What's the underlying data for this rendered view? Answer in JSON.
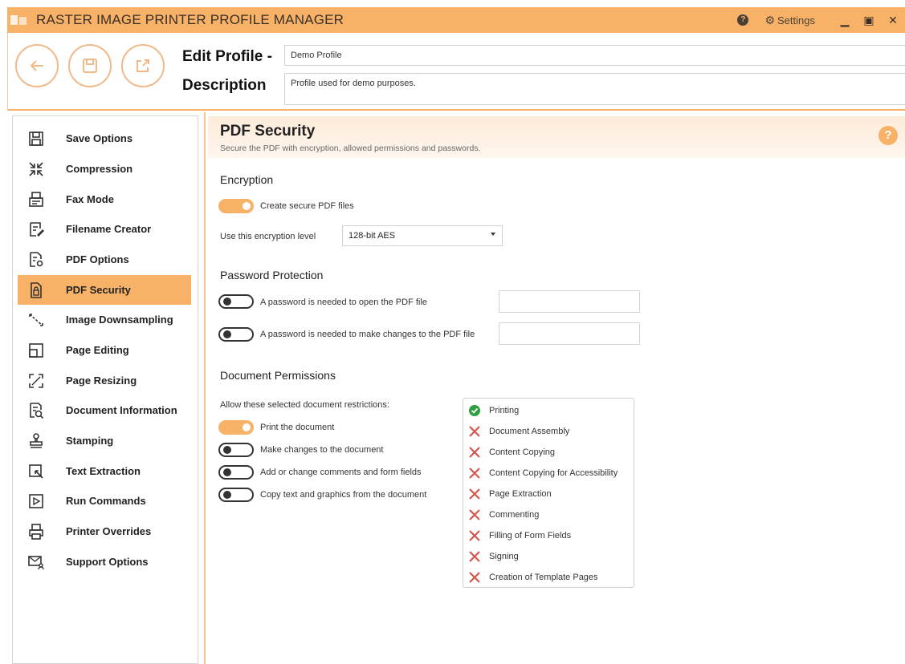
{
  "app": {
    "title": "RASTER IMAGE PRINTER PROFILE MANAGER",
    "settings_label": "Settings"
  },
  "header": {
    "profile_label": "Edit Profile -",
    "profile_name": "Demo Profile",
    "description_label": "Description",
    "description_value": "Profile used for demo purposes."
  },
  "sidebar": {
    "items": [
      {
        "label": "Save Options",
        "icon": "save-icon"
      },
      {
        "label": "Compression",
        "icon": "compress-icon"
      },
      {
        "label": "Fax Mode",
        "icon": "fax-icon"
      },
      {
        "label": "Filename Creator",
        "icon": "filename-icon"
      },
      {
        "label": "PDF Options",
        "icon": "pdf-options-icon"
      },
      {
        "label": "PDF Security",
        "icon": "lock-icon",
        "active": true
      },
      {
        "label": "Image Downsampling",
        "icon": "downsample-icon"
      },
      {
        "label": "Page Editing",
        "icon": "page-edit-icon"
      },
      {
        "label": "Page Resizing",
        "icon": "resize-icon"
      },
      {
        "label": "Document Information",
        "icon": "doc-info-icon"
      },
      {
        "label": "Stamping",
        "icon": "stamp-icon"
      },
      {
        "label": "Text Extraction",
        "icon": "text-extract-icon"
      },
      {
        "label": "Run Commands",
        "icon": "run-icon"
      },
      {
        "label": "Printer Overrides",
        "icon": "printer-icon"
      },
      {
        "label": "Support Options",
        "icon": "support-icon"
      }
    ]
  },
  "main": {
    "title": "PDF Security",
    "subtitle": "Secure the PDF with encryption, allowed permissions and passwords.",
    "encryption": {
      "title": "Encryption",
      "secure_toggle_label": "Create secure PDF files",
      "secure_toggle_on": true,
      "level_label": "Use this encryption level",
      "level_value": "128-bit AES"
    },
    "password": {
      "title": "Password Protection",
      "open_label": "A password is needed to open the PDF file",
      "open_on": false,
      "change_label": "A password is needed to make changes to the PDF file",
      "change_on": false
    },
    "permissions": {
      "title": "Document Permissions",
      "allow_label": "Allow these selected document restrictions:",
      "toggles": [
        {
          "label": "Print the document",
          "on": true
        },
        {
          "label": "Make changes to the document",
          "on": false
        },
        {
          "label": "Add or change comments and form fields",
          "on": false
        },
        {
          "label": "Copy text and graphics from the document",
          "on": false
        }
      ],
      "list": [
        {
          "label": "Printing",
          "allowed": true
        },
        {
          "label": "Document Assembly",
          "allowed": false
        },
        {
          "label": "Content Copying",
          "allowed": false
        },
        {
          "label": "Content Copying for Accessibility",
          "allowed": false
        },
        {
          "label": "Page Extraction",
          "allowed": false
        },
        {
          "label": "Commenting",
          "allowed": false
        },
        {
          "label": "Filling of Form Fields",
          "allowed": false
        },
        {
          "label": "Signing",
          "allowed": false
        },
        {
          "label": "Creation of Template Pages",
          "allowed": false
        }
      ]
    }
  },
  "colors": {
    "accent": "#f7b267",
    "allowed": "#2e9e3e",
    "denied": "#d9534f"
  }
}
